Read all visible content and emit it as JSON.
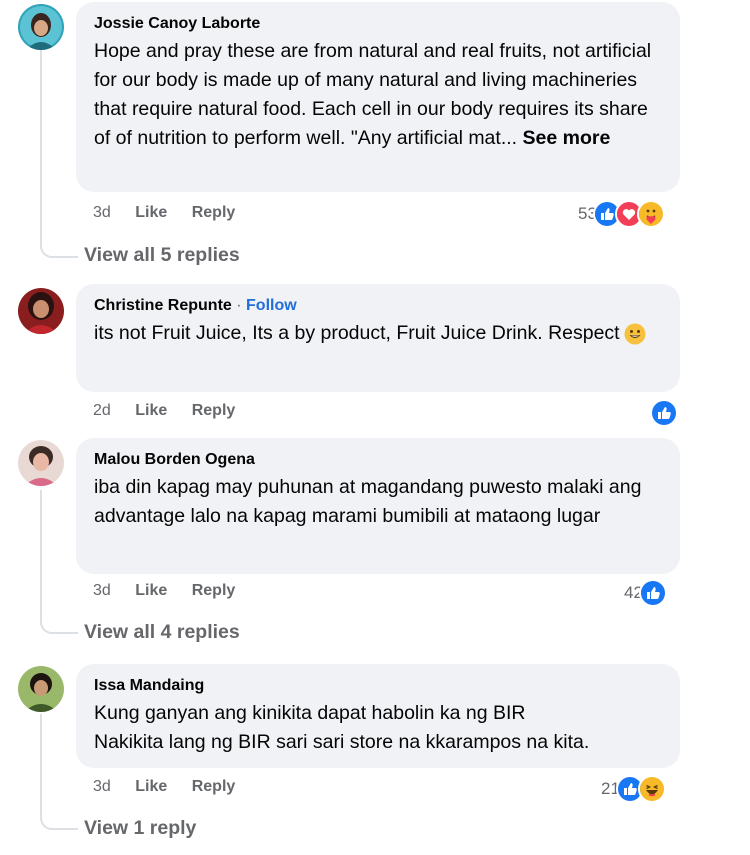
{
  "comments": [
    {
      "author": "Jossie Canoy Laborte",
      "text": "Hope and pray these are from natural and real fruits, not artificial for our body is made up of many natural and living machineries that require natural food. Each cell in our body requires its share of of nutrition to perform well. \"Any artificial mat...",
      "see_more": "See more",
      "time": "3d",
      "like": "Like",
      "reply": "Reply",
      "reaction_count": "53",
      "reactions": [
        "like-icon",
        "love-icon",
        "care-icon"
      ],
      "view_replies": "View all 5 replies"
    },
    {
      "author": "Christine Repunte",
      "separator": "·",
      "follow": "Follow",
      "text": "its not Fruit Juice, Its a by product, Fruit Juice Drink. Respect",
      "emoji": "grinning-emoji",
      "time": "2d",
      "like": "Like",
      "reply": "Reply",
      "reactions": [
        "like-icon"
      ]
    },
    {
      "author": "Malou Borden Ogena",
      "text": "iba din kapag may puhunan at magandang puwesto malaki ang advantage lalo na kapag marami bumibili at mataong lugar",
      "time": "3d",
      "like": "Like",
      "reply": "Reply",
      "reaction_count": "42",
      "reactions": [
        "like-icon"
      ],
      "view_replies": "View all 4 replies"
    },
    {
      "author": "Issa Mandaing",
      "text_line1": "Kung ganyan ang kinikita dapat habolin ka ng BIR",
      "text_line2": "Nakikita lang ng BIR sari sari store na kkarampos na kita.",
      "time": "3d",
      "like": "Like",
      "reply": "Reply",
      "reaction_count": "21",
      "reactions": [
        "like-icon",
        "haha-icon"
      ],
      "view_replies": "View 1 reply"
    }
  ],
  "colors": {
    "bubble": "#f0f2f5",
    "meta_text": "#65676b",
    "follow_link": "#216fdb",
    "like_blue": "#1877f2",
    "love_red": "#f33e58",
    "thread_line": "#dcdfe3"
  }
}
